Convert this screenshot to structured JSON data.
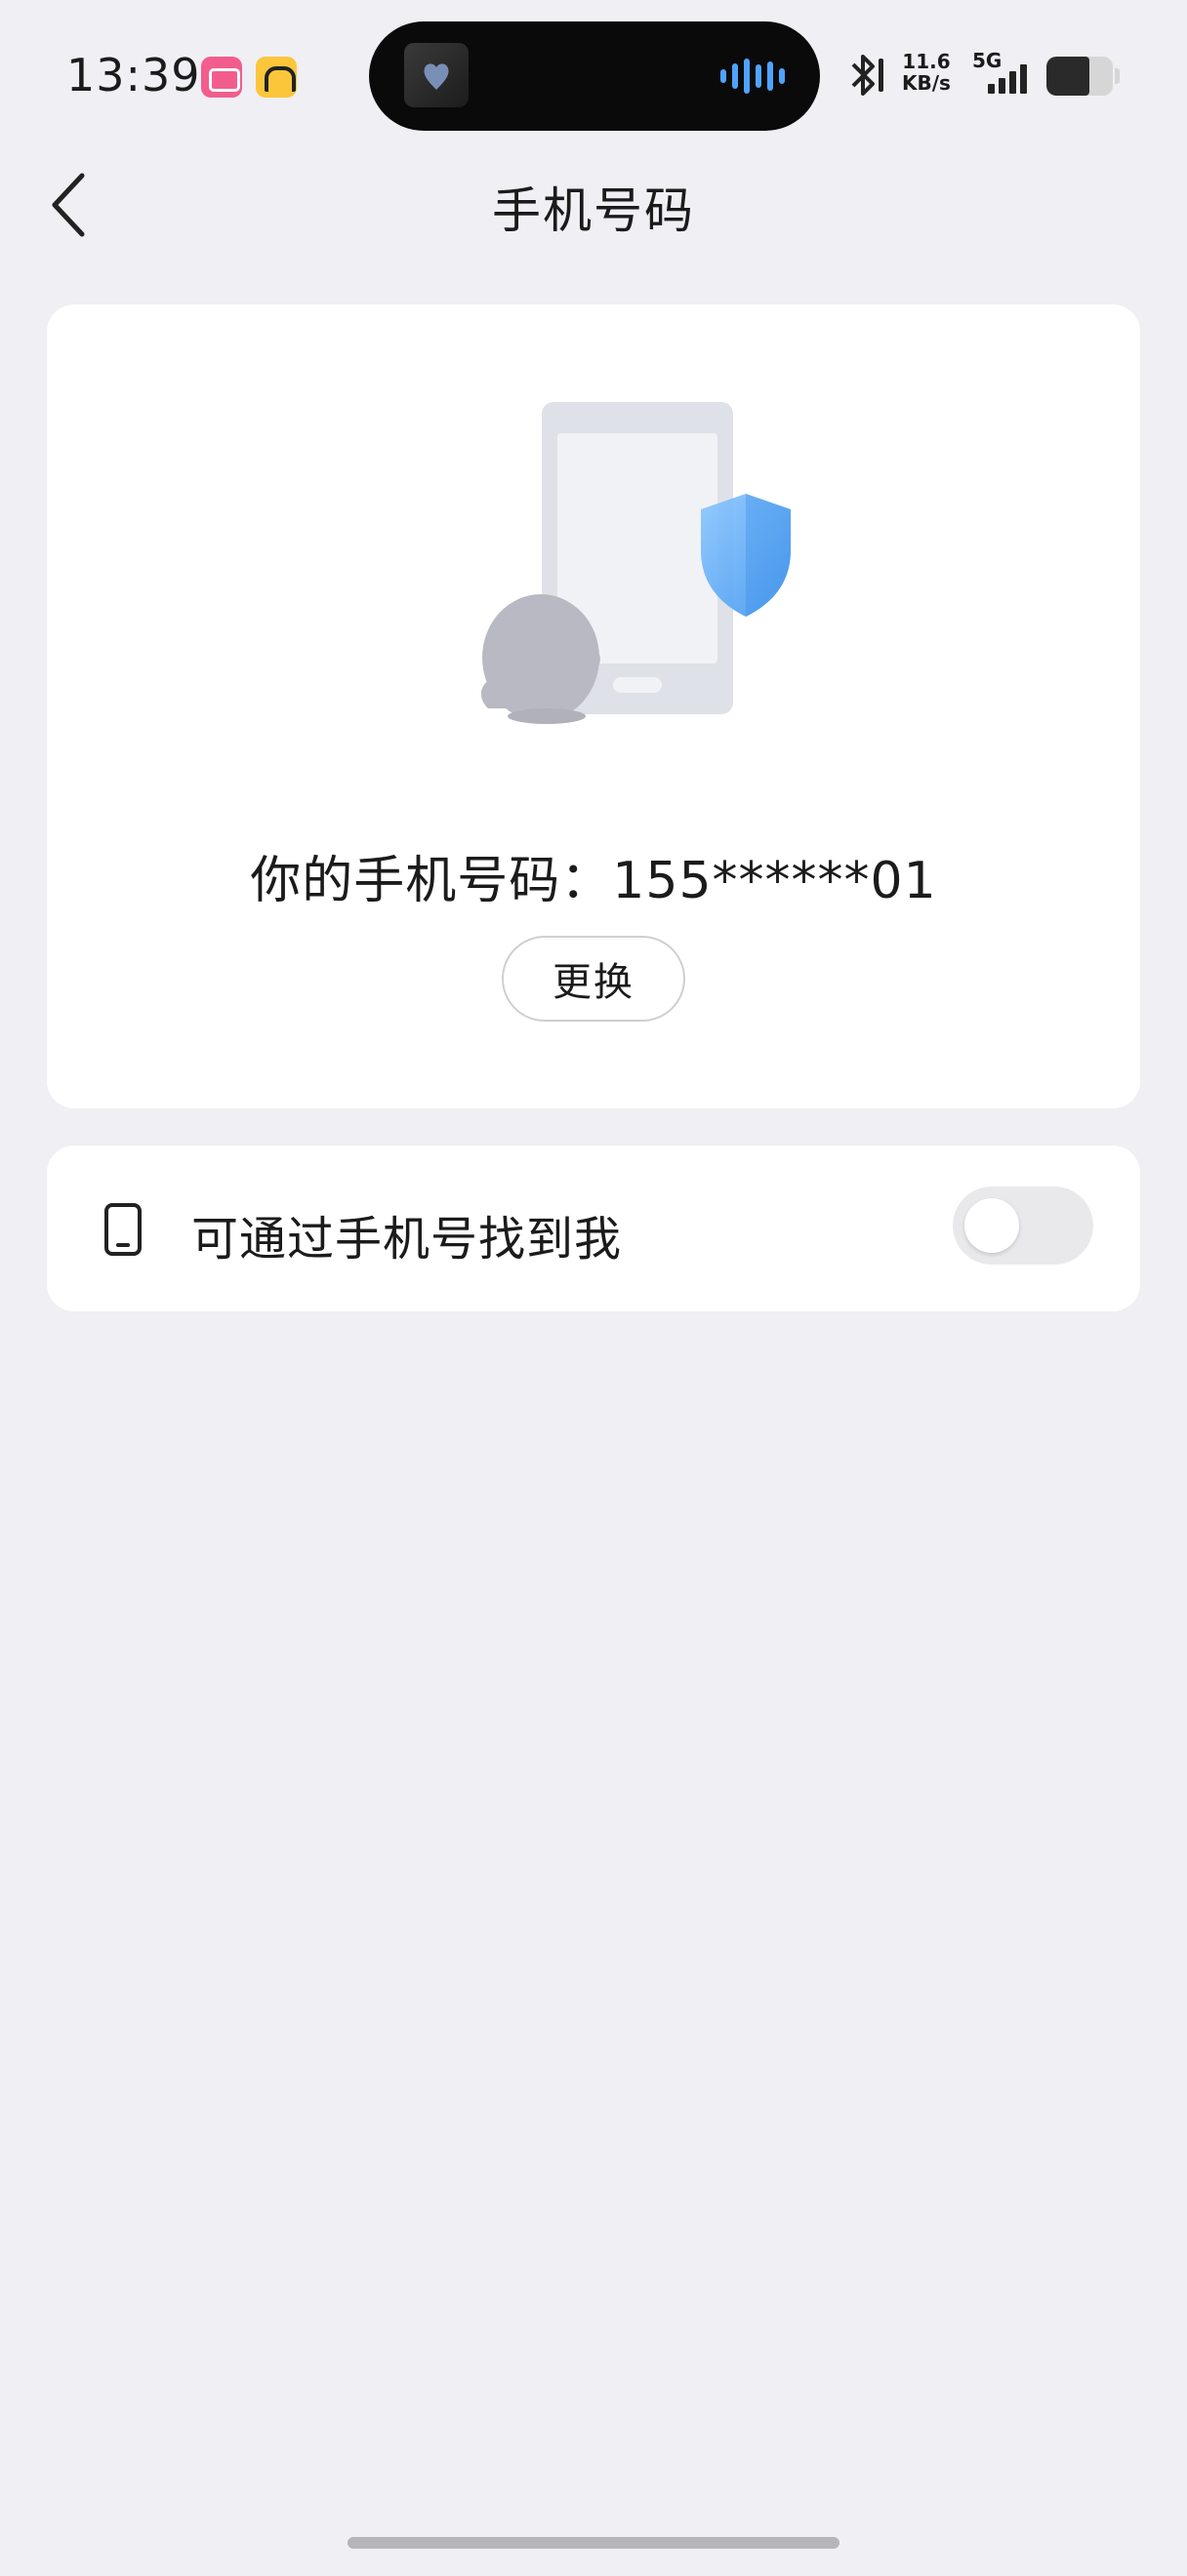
{
  "status_bar": {
    "time": "13:39",
    "speed_value": "11.6",
    "speed_unit": "KB/s",
    "network": "5G",
    "app_icons": [
      "bilibili-icon",
      "didi-icon"
    ],
    "battery_level_percent": 65
  },
  "nav": {
    "title": "手机号码",
    "back_icon": "chevron-left-icon"
  },
  "phone_card": {
    "illustration": "phone-shield-penguin-illustration",
    "label": "你的手机号码：155******01",
    "change_button": "更换"
  },
  "find_by_phone": {
    "icon": "mobile-phone-icon",
    "label": "可通过手机号找到我",
    "enabled": false
  },
  "colors": {
    "background": "#efeff4",
    "card": "#ffffff",
    "shield_blue": "#5aaaf5",
    "toggle_off": "#e9e9ec"
  }
}
